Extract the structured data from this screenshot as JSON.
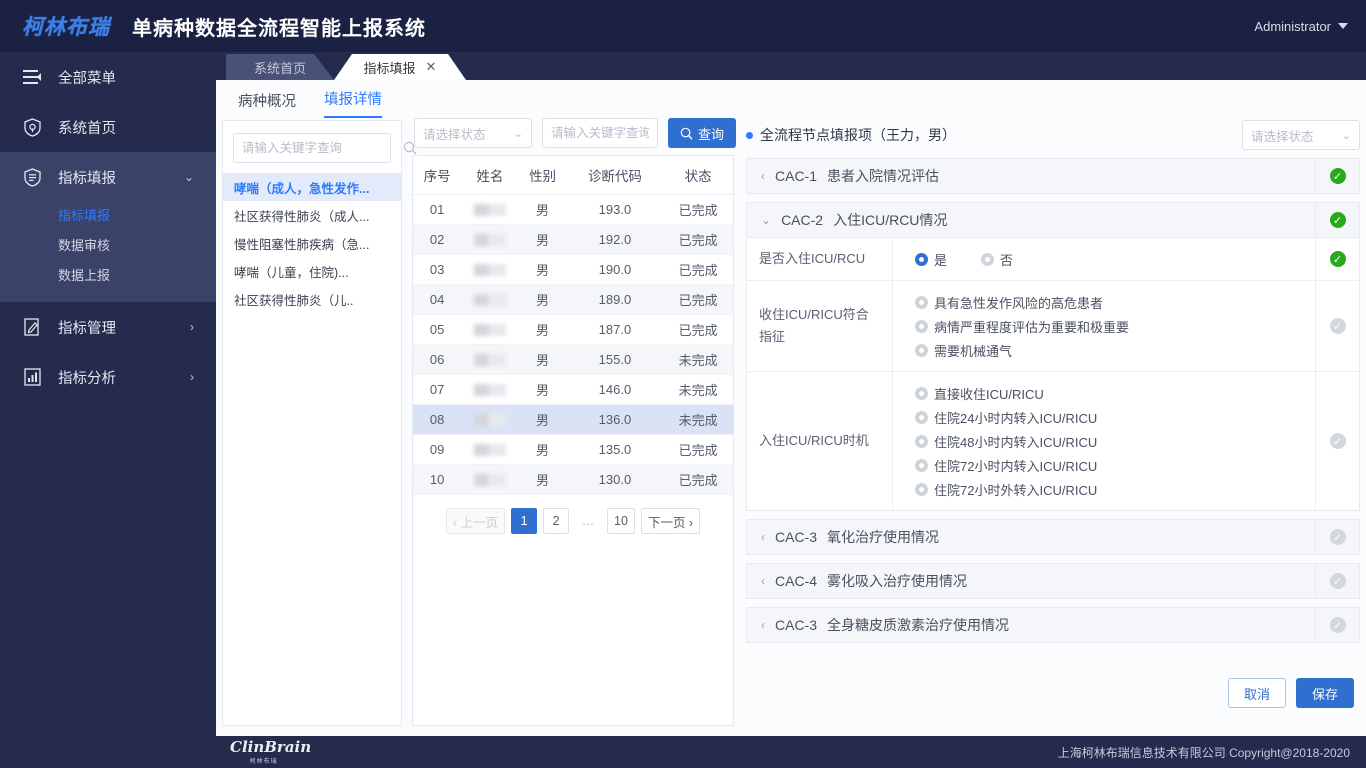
{
  "header": {
    "logo_text": "柯林布瑞",
    "title": "单病种数据全流程智能上报系统",
    "user": "Administrator"
  },
  "sidebar": {
    "items": [
      {
        "label": "全部菜单",
        "icon": "menu-icon"
      },
      {
        "label": "系统首页",
        "icon": "home-shield-icon"
      },
      {
        "label": "指标填报",
        "icon": "form-shield-icon",
        "arrow": "⌄",
        "children": [
          {
            "label": "指标填报",
            "active": true
          },
          {
            "label": "数据审核",
            "active": false
          },
          {
            "label": "数据上报",
            "active": false
          }
        ]
      },
      {
        "label": "指标管理",
        "icon": "edit-doc-icon",
        "arrow": "›"
      },
      {
        "label": "指标分析",
        "icon": "analysis-icon",
        "arrow": "›"
      }
    ]
  },
  "tabs": [
    {
      "label": "系统首页",
      "active": false
    },
    {
      "label": "指标填报",
      "active": true,
      "close": "✕"
    }
  ],
  "subtabs": [
    {
      "label": "病种概况",
      "active": false
    },
    {
      "label": "填报详情",
      "active": true
    }
  ],
  "disease_panel": {
    "search_placeholder": "请输入关键字查询",
    "search_value": "",
    "items": [
      {
        "label": "哮喘（成人，急性发作...",
        "active": true
      },
      {
        "label": "社区获得性肺炎（成人...",
        "active": false
      },
      {
        "label": "慢性阻塞性肺疾病（急...",
        "active": false
      },
      {
        "label": "哮喘（儿童，住院)...",
        "active": false
      },
      {
        "label": "社区获得性肺炎（儿..",
        "active": false
      }
    ]
  },
  "filters": {
    "status_placeholder": "请选择状态",
    "keyword_placeholder": "请输入关键字查询",
    "keyword_value": "",
    "query_button": "查询"
  },
  "patient_table": {
    "columns": [
      "序号",
      "姓名",
      "性别",
      "诊断代码",
      "状态"
    ],
    "rows": [
      {
        "no": "01",
        "name": "",
        "sex": "男",
        "code": "193.0",
        "status": "已完成",
        "done": true,
        "selected": false
      },
      {
        "no": "02",
        "name": "",
        "sex": "男",
        "code": "192.0",
        "status": "已完成",
        "done": true,
        "selected": false
      },
      {
        "no": "03",
        "name": "",
        "sex": "男",
        "code": "190.0",
        "status": "已完成",
        "done": true,
        "selected": false
      },
      {
        "no": "04",
        "name": "",
        "sex": "男",
        "code": "189.0",
        "status": "已完成",
        "done": true,
        "selected": false
      },
      {
        "no": "05",
        "name": "",
        "sex": "男",
        "code": "187.0",
        "status": "已完成",
        "done": true,
        "selected": false
      },
      {
        "no": "06",
        "name": "",
        "sex": "男",
        "code": "155.0",
        "status": "未完成",
        "done": false,
        "selected": false
      },
      {
        "no": "07",
        "name": "",
        "sex": "男",
        "code": "146.0",
        "status": "未完成",
        "done": false,
        "selected": false
      },
      {
        "no": "08",
        "name": "",
        "sex": "男",
        "code": "136.0",
        "status": "未完成",
        "done": false,
        "selected": true
      },
      {
        "no": "09",
        "name": "",
        "sex": "男",
        "code": "135.0",
        "status": "已完成",
        "done": true,
        "selected": false
      },
      {
        "no": "10",
        "name": "",
        "sex": "男",
        "code": "130.0",
        "status": "已完成",
        "done": true,
        "selected": false
      }
    ]
  },
  "pagination": {
    "prev": "‹ 上一页",
    "pages": [
      "1",
      "2",
      "…",
      "10"
    ],
    "current": "1",
    "next": "下一页 ›"
  },
  "form": {
    "title": "全流程节点填报项（王力，男）",
    "status_placeholder": "请选择状态",
    "sections": [
      {
        "code": "CAC-1",
        "name": "患者入院情况评估",
        "expanded": false,
        "status": "ok",
        "tri": "‹"
      },
      {
        "code": "CAC-2",
        "name": "入住ICU/RCU情况",
        "expanded": true,
        "status": "ok",
        "tri": "⌄",
        "rows": [
          {
            "label": "是否入住ICU/RCU",
            "layout": "inline",
            "status": "ok",
            "options": [
              {
                "label": "是",
                "selected": true
              },
              {
                "label": "否",
                "selected": false
              }
            ]
          },
          {
            "label": "收住ICU/RICU符合指征",
            "layout": "stack",
            "status": "off",
            "options": [
              {
                "label": "具有急性发作风险的高危患者",
                "selected": false
              },
              {
                "label": "病情严重程度评估为重要和极重要",
                "selected": false
              },
              {
                "label": "需要机械通气",
                "selected": false
              }
            ]
          },
          {
            "label": "入住ICU/RICU时机",
            "layout": "stack",
            "status": "off",
            "options": [
              {
                "label": "直接收住ICU/RICU",
                "selected": false
              },
              {
                "label": "住院24小时内转入ICU/RICU",
                "selected": false
              },
              {
                "label": "住院48小时内转入ICU/RICU",
                "selected": false
              },
              {
                "label": "住院72小时内转入ICU/RICU",
                "selected": false
              },
              {
                "label": "住院72小时外转入ICU/RICU",
                "selected": false
              }
            ]
          }
        ]
      },
      {
        "code": "CAC-3",
        "name": "氧化治疗使用情况",
        "expanded": false,
        "status": "off",
        "tri": "‹"
      },
      {
        "code": "CAC-4",
        "name": "雾化吸入治疗使用情况",
        "expanded": false,
        "status": "off",
        "tri": "‹"
      },
      {
        "code": "CAC-3",
        "name": "全身糖皮质激素治疗使用情况",
        "expanded": false,
        "status": "off",
        "tri": "‹"
      }
    ],
    "cancel_button": "取消",
    "save_button": "保存"
  },
  "footer": {
    "logo": "ClinBrain",
    "logo_sub": "柯林布瑞",
    "copyright": "上海柯林布瑞信息技术有限公司 Copyright@2018-2020"
  },
  "colors": {
    "brand_dark": "#1b2143",
    "sidebar": "#242b4d",
    "accent": "#2f6fd0",
    "link": "#2f7bff",
    "success": "#26a244",
    "danger": "#e8413a"
  }
}
